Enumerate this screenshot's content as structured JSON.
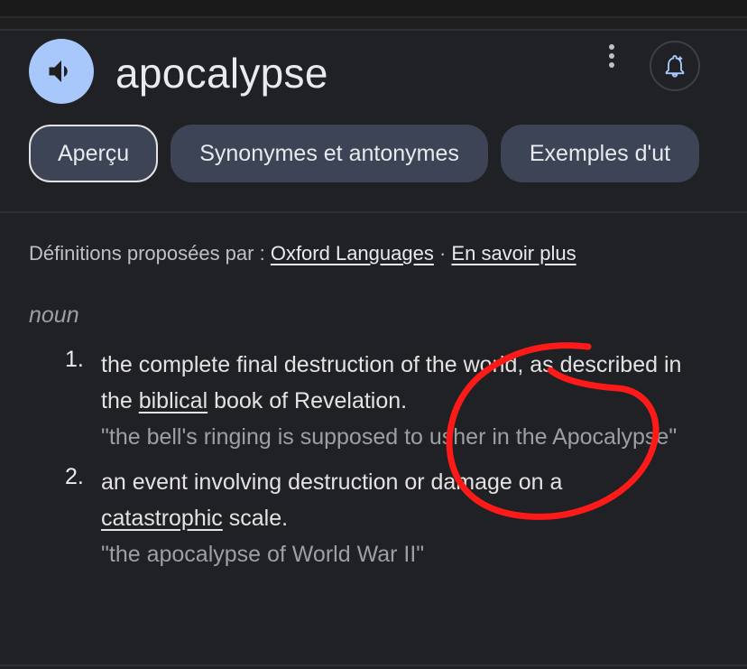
{
  "header": {
    "word": "apocalypse"
  },
  "tabs": [
    {
      "label": "Aperçu",
      "active": true
    },
    {
      "label": "Synonymes et antonymes",
      "active": false
    },
    {
      "label": "Exemples d'ut",
      "active": false
    }
  ],
  "source": {
    "prefix": "Définitions proposées par : ",
    "provider": "Oxford Languages",
    "separator": " · ",
    "learn_more": "En savoir plus"
  },
  "part_of_speech": "noun",
  "definitions": [
    {
      "number": "1.",
      "text_before": "the complete final destruction of the world, as described in the ",
      "link": "biblical",
      "text_after": " book of Revelation.",
      "example": "\"the bell's ringing is supposed to usher in the Apocalypse\""
    },
    {
      "number": "2.",
      "text_before": "an event involving destruction or damage on a ",
      "link": "catastrophic",
      "text_after": " scale.",
      "example": "\"the apocalypse of World War II\""
    }
  ],
  "icons": {
    "speaker": "speaker-icon",
    "more": "more-vert-icon",
    "bell": "bell-add-icon"
  },
  "colors": {
    "background": "#202124",
    "speaker_bg": "#a8c7fa",
    "tab_bg": "#3c4455",
    "annotation": "#ff1a1a"
  }
}
